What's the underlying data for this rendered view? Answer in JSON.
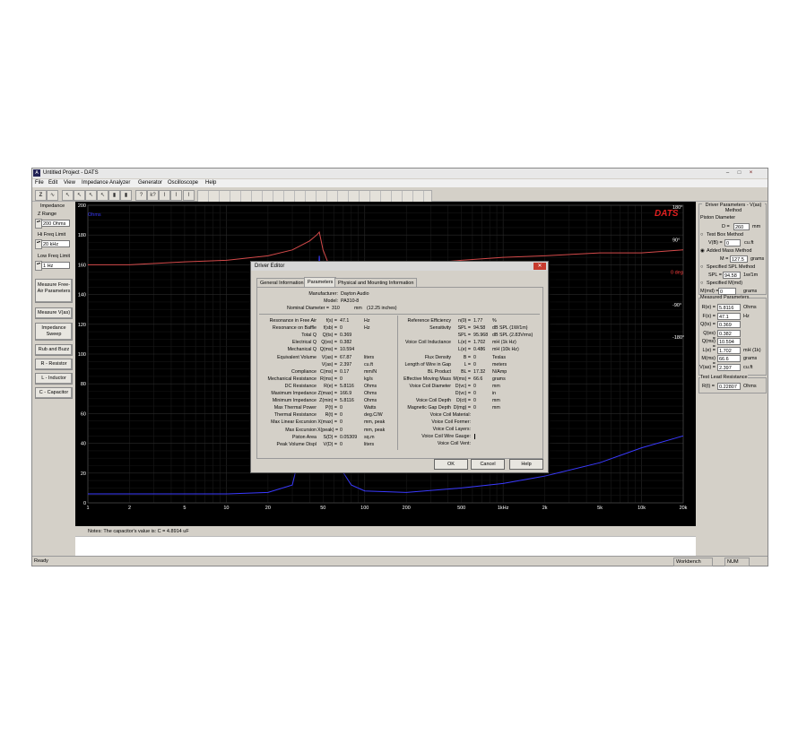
{
  "window": {
    "title": "Untitled Project - DATS",
    "min": "–",
    "max": "□",
    "close": "×"
  },
  "menu": [
    "File",
    "Edit",
    "View",
    "Impedance Analyzer",
    "Generator",
    "Oscilloscope",
    "Help"
  ],
  "toolbar_icons": [
    "z-icon",
    "sine-icon",
    "cursor-icon",
    "cursor-icon",
    "cursor-icon",
    "cursor-icon",
    "cursor-icon",
    "cursor-icon",
    "bars-icon",
    "bars-icon",
    "probe-icon",
    "probe-icon",
    "probe-icon",
    "probe-icon",
    "probe-icon"
  ],
  "left": {
    "impedance_title": "Impedance",
    "z_range_label": "Z Range",
    "z_range_value": "200 Ohms",
    "hi_freq_label": "Hi Freq Limit",
    "hi_freq_value": "20 kHz",
    "low_freq_label": "Low Freq Limit",
    "low_freq_value": "1 Hz",
    "btn_free_air": "Measure Free-Air Parameters",
    "btn_vas": "Measure V(as)",
    "btn_sweep": "Impedance Sweep",
    "btn_rub": "Rub and Buzz",
    "btn_resistor": "R - Resistor",
    "btn_inductor": "L - Inductor",
    "btn_capacitor": "C - Capacitor"
  },
  "chart_data": {
    "type": "line",
    "logo": "DATS",
    "y_unit": "Ohms",
    "y_ticks": [
      "200",
      "180",
      "160",
      "140",
      "120",
      "100",
      "80",
      "60",
      "40",
      "20",
      "0"
    ],
    "y_right_ticks": [
      "180°",
      "90°",
      "0 deg",
      "-90°",
      "-180°"
    ],
    "x_ticks": [
      "1",
      "2",
      "5",
      "10",
      "20",
      "50",
      "100",
      "200",
      "500",
      "1kHz",
      "2k",
      "5k",
      "10k",
      "20k"
    ],
    "x_tick_values": [
      1,
      2,
      5,
      10,
      20,
      50,
      100,
      200,
      500,
      1000,
      2000,
      5000,
      10000,
      20000
    ],
    "xlim": [
      1,
      20000
    ],
    "ylim": [
      0,
      200
    ],
    "x_scale": "log",
    "grid": true,
    "series": [
      {
        "color": "#3a3aff",
        "x": [
          1,
          2,
          5,
          10,
          20,
          30,
          40,
          45,
          47,
          50,
          55,
          60,
          80,
          100,
          200,
          500,
          1000,
          2000,
          5000,
          10000,
          20000
        ],
        "y": [
          6,
          6,
          6,
          6,
          7,
          12,
          60,
          130,
          166,
          120,
          60,
          30,
          12,
          8,
          7,
          10,
          13,
          18,
          27,
          37,
          45
        ]
      },
      {
        "color": "#d44a4a",
        "x": [
          1,
          2,
          5,
          10,
          20,
          30,
          40,
          45,
          47,
          50,
          55,
          60,
          80,
          100,
          200,
          500,
          1000,
          2000,
          5000,
          10000,
          20000
        ],
        "y": [
          160,
          160,
          162,
          163,
          166,
          170,
          176,
          180,
          182,
          170,
          160,
          159,
          159,
          159,
          160,
          163,
          165,
          166,
          168,
          168,
          170
        ]
      }
    ]
  },
  "notes": "Notes:  The capacitor's value is:  C = 4.8914 uF",
  "right": {
    "section1_title": "Driver Parameters - V(as) Method",
    "piston_label": "Piston Diameter",
    "d_label": "D =",
    "d_value": "260",
    "d_unit": "mm",
    "test_box": "Test Box Method",
    "vb_label": "V(B) =",
    "vb_value": "0",
    "vb_unit": "cu.ft",
    "added_mass": "Added Mass Method",
    "m_label": "M =",
    "m_value": "127.5",
    "m_unit": "grams",
    "spl_method": "Specified SPL Method",
    "spl_label": "SPL =",
    "spl_value": "94.58",
    "spl_unit": "1w/1m",
    "md_method": "Specified M(md)",
    "md_label": "M(md) =",
    "md_value": "0",
    "md_unit": "grams",
    "measured_title": "Measured Parameters",
    "measured": [
      {
        "k": "R(e) =",
        "v": "5.8116",
        "u": "Ohms"
      },
      {
        "k": "F(s) =",
        "v": "47.1",
        "u": "Hz"
      },
      {
        "k": "Q(ts) =",
        "v": "0.369",
        "u": ""
      },
      {
        "k": "Q(es) =",
        "v": "0.382",
        "u": ""
      },
      {
        "k": "Q(ms) =",
        "v": "10.594",
        "u": ""
      },
      {
        "k": "L(e) =",
        "v": "1.702",
        "u": "mH (1k)"
      },
      {
        "k": "M(ms) =",
        "v": "66.6",
        "u": "grams"
      },
      {
        "k": "V(as) =",
        "v": "2.397",
        "u": "cu.ft"
      }
    ],
    "test_lead_title": "Test Lead Resistance",
    "rt_label": "R(t) =",
    "rt_value": "0.22807",
    "rt_unit": "Ohms"
  },
  "status": {
    "ready": "Ready",
    "workbench": "Workbench",
    "num": "NUM"
  },
  "dialog": {
    "title": "Driver Editor",
    "tabs": [
      "General Information",
      "Parameters",
      "Physical and Mounting Information"
    ],
    "manufacturer_label": "Manufacturer:",
    "manufacturer": "Dayton Audio",
    "model_label": "Model:",
    "model": "PA310-8",
    "nominal_label": "Nominal Diameter =",
    "nominal_value": "310",
    "nominal_unit": "mm",
    "nominal_inches": "(12.25  inches)",
    "left_rows": [
      {
        "label": "Resonance in Free Air",
        "sym": "f(s) =",
        "val": "47.1",
        "unit": "Hz"
      },
      {
        "label": "Resonance on Baffle",
        "sym": "f(sb) =",
        "val": "0",
        "unit": "Hz"
      },
      {
        "label": "Total Q",
        "sym": "Q(ts) =",
        "val": "0.369",
        "unit": ""
      },
      {
        "label": "Electrical Q",
        "sym": "Q(es) =",
        "val": "0.382",
        "unit": ""
      },
      {
        "label": "Mechanical Q",
        "sym": "Q(ms) =",
        "val": "10.594",
        "unit": ""
      },
      {
        "label": "Equivalent Volume",
        "sym": "V(as) =",
        "val": "67.87",
        "unit": "liters"
      },
      {
        "label": "",
        "sym": "V(as) =",
        "val": "2.397",
        "unit": "cu.ft"
      },
      {
        "label": "Compliance",
        "sym": "C(ms) =",
        "val": "0.17",
        "unit": "mm/N"
      },
      {
        "label": "Mechanical Resistance",
        "sym": "R(ms) =",
        "val": "0",
        "unit": "kg/s"
      },
      {
        "label": "DC Resistance",
        "sym": "R(e) =",
        "val": "5.8116",
        "unit": "Ohms"
      },
      {
        "label": "Maximum Impedance",
        "sym": "Z(max) =",
        "val": "166.9",
        "unit": "Ohms"
      },
      {
        "label": "Minimum Impedance",
        "sym": "Z(min) =",
        "val": "5.8116",
        "unit": "Ohms"
      },
      {
        "label": "Max Thermal Power",
        "sym": "P(t) =",
        "val": "0",
        "unit": "Watts"
      },
      {
        "label": "Thermal Resistance",
        "sym": "R(t) =",
        "val": "0",
        "unit": "deg.C/W"
      },
      {
        "label": "Max Linear Excursion",
        "sym": "X(max) =",
        "val": "0",
        "unit": "mm, peak"
      },
      {
        "label": "Max Excursion",
        "sym": "X(peak) =",
        "val": "0",
        "unit": "mm, peak"
      },
      {
        "label": "Piston Area",
        "sym": "S(D) =",
        "val": "0.05309",
        "unit": "sq.m"
      },
      {
        "label": "Peak Volume Displ",
        "sym": "V(D) =",
        "val": "0",
        "unit": "liters"
      }
    ],
    "right_rows": [
      {
        "label": "Reference Efficiency",
        "sym": "n(0) =",
        "val": "1.77",
        "unit": "%"
      },
      {
        "label": "Sensitivity",
        "sym": "SPL =",
        "val": "94.58",
        "unit": "dB SPL (1W/1m)"
      },
      {
        "label": "",
        "sym": "SPL =",
        "val": "95.968",
        "unit": "dB SPL (2.83Vrms)"
      },
      {
        "label": "Voice Coil Inductance",
        "sym": "L(e) =",
        "val": "1.702",
        "unit": "mH (1k Hz)"
      },
      {
        "label": "",
        "sym": "L(e) =",
        "val": "0.486",
        "unit": "mH (10k Hz)"
      },
      {
        "label": "Flux Density",
        "sym": "B =",
        "val": "0",
        "unit": "Teslas"
      },
      {
        "label": "Length of Wire in Gap",
        "sym": "L =",
        "val": "0",
        "unit": "meters"
      },
      {
        "label": "BL Product",
        "sym": "BL =",
        "val": "17.32",
        "unit": "N/Amp"
      },
      {
        "label": "Effective Moving Mass",
        "sym": "M(ms) =",
        "val": "66.6",
        "unit": "grams"
      },
      {
        "label": "Voice Coil Diameter",
        "sym": "D(vc) =",
        "val": "0",
        "unit": "mm"
      },
      {
        "label": "",
        "sym": "D(vc) =",
        "val": "0",
        "unit": "in"
      },
      {
        "label": "Voice Coil Depth",
        "sym": "D(ct) =",
        "val": "0",
        "unit": "mm"
      },
      {
        "label": "Magnetic Gap Depth",
        "sym": "D(mg) =",
        "val": "0",
        "unit": "mm"
      }
    ],
    "text_rows": [
      "Voice Coil Material:",
      "Voice Coil Former:",
      "Voice Coil Layers:",
      "Voice Coil Wire Gauge:",
      "Voice Coil Vent:"
    ],
    "ok": "OK",
    "cancel": "Cancel",
    "help": "Help"
  }
}
